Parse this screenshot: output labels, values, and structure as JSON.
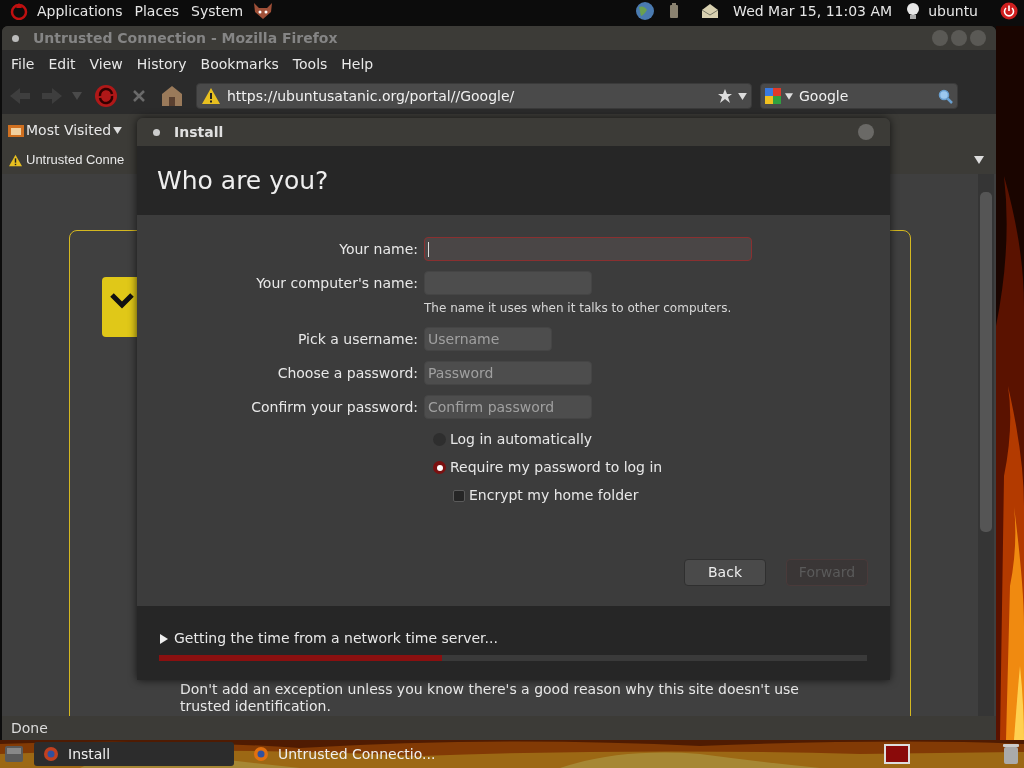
{
  "top_panel": {
    "menus": [
      "Applications",
      "Places",
      "System"
    ],
    "clock": "Wed Mar 15, 11:03 AM",
    "user": "ubuntu"
  },
  "browser": {
    "title": "Untrusted Connection - Mozilla Firefox",
    "menu": [
      "File",
      "Edit",
      "View",
      "History",
      "Bookmarks",
      "Tools",
      "Help"
    ],
    "url": "https://ubuntusatanic.org/portal//Google/",
    "search": {
      "value": "Google"
    },
    "bookmarks": [
      "Most Visited"
    ],
    "tab": "Untrusted Conne",
    "page_text": "Don't add an exception unless you know there's a good reason why this site doesn't use trusted identification.",
    "status": "Done"
  },
  "dialog": {
    "title": "Install",
    "heading": "Who are you?",
    "fields": [
      {
        "label": "Your name:",
        "focused": true
      },
      {
        "label": "Your computer's name:",
        "focused": false,
        "hint": "The name it uses when it talks to other computers."
      },
      {
        "label": "Pick a username:",
        "focused": false,
        "placeholder": "Username"
      },
      {
        "label": "Choose a password:",
        "focused": false,
        "placeholder": "Password"
      },
      {
        "label": "Confirm your password:",
        "focused": false,
        "placeholder": "Confirm password"
      }
    ],
    "options": [
      {
        "kind": "radio",
        "label": "Log in automatically",
        "selected": false
      },
      {
        "kind": "radio",
        "label": "Require my password to log in",
        "selected": true
      },
      {
        "kind": "checkbox",
        "label": "Encrypt my home folder",
        "checked": false
      }
    ],
    "buttons": [
      {
        "label": "Back",
        "disabled": false
      },
      {
        "label": "Forward",
        "disabled": true
      }
    ],
    "progress": {
      "label": "Getting the time from a network time server...",
      "expanded": false,
      "level": 0.4
    }
  },
  "taskbar": [
    {
      "label": "Install",
      "selected": true
    },
    {
      "label": "Untrusted Connectio...",
      "selected": false
    }
  ]
}
